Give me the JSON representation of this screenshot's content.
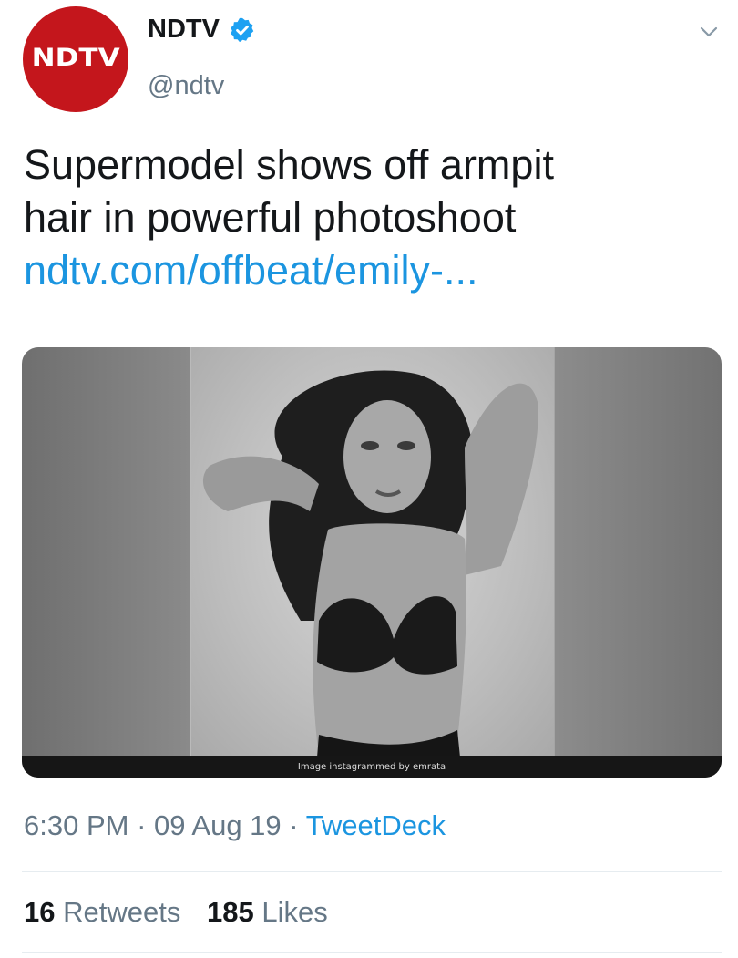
{
  "account": {
    "avatar_text": "NDTV",
    "display_name": "NDTV",
    "handle": "@ndtv",
    "verified_icon": "verified-badge-icon",
    "menu_icon": "chevron-down-icon",
    "avatar_color": "#c4161c",
    "verified_color": "#1da1f2"
  },
  "tweet": {
    "text_line_1": "Supermodel shows off armpit",
    "text_line_2": "hair in powerful photoshoot",
    "link": "ndtv.com/offbeat/emily-..."
  },
  "media": {
    "caption": "Image instagrammed by emrata"
  },
  "meta": {
    "time": "6:30 PM",
    "date": "09 Aug 19",
    "source": "TweetDeck",
    "separator": "·"
  },
  "stats": {
    "retweets_count": "16",
    "retweets_label": "Retweets",
    "likes_count": "185",
    "likes_label": "Likes"
  },
  "colors": {
    "link": "#1b95e0",
    "secondary_text": "#657786",
    "primary_text": "#14171a"
  }
}
